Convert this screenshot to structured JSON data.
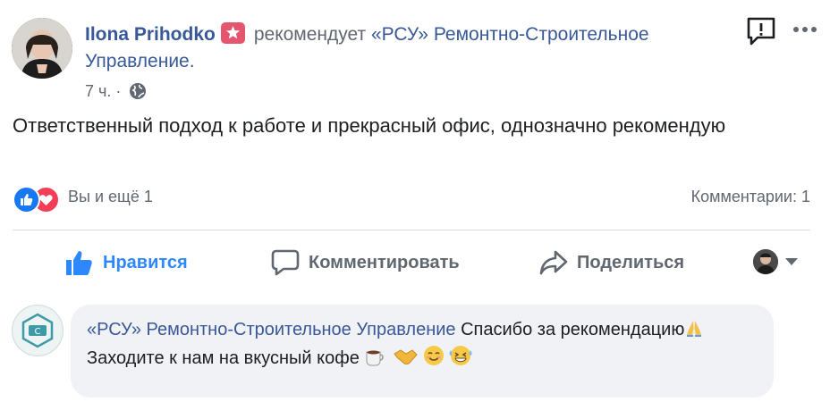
{
  "post": {
    "author": "Ilona Prihodko",
    "action_text": "рекомендует",
    "page_name": "«РСУ» Ремонтно-Строительное Управление.",
    "time": "7 ч.",
    "privacy_icon": "globe-icon",
    "text": "Ответственный подход к работе и прекрасный офис, однозначно рекомендую"
  },
  "reactions": {
    "icons": [
      "like-reaction-icon",
      "love-reaction-icon"
    ],
    "summary": "Вы и ещё 1"
  },
  "comments_count": "Комментарии: 1",
  "actions": {
    "like": "Нравится",
    "comment": "Комментировать",
    "share": "Поделиться"
  },
  "comment": {
    "author": "«РСУ» Ремонтно-Строительное Управление",
    "text_line1": "Спасибо за рекомендацию",
    "text_line2": "Заходите к нам на вкусный кофе",
    "emojis": [
      "folded-hands",
      "coffee",
      "handshake",
      "smiling-face",
      "grinning-sweat"
    ]
  },
  "colors": {
    "link": "#385898",
    "like_active": "#2d88ff",
    "badge": "#e3566e",
    "love": "#f33e58",
    "like": "#1877f2"
  }
}
